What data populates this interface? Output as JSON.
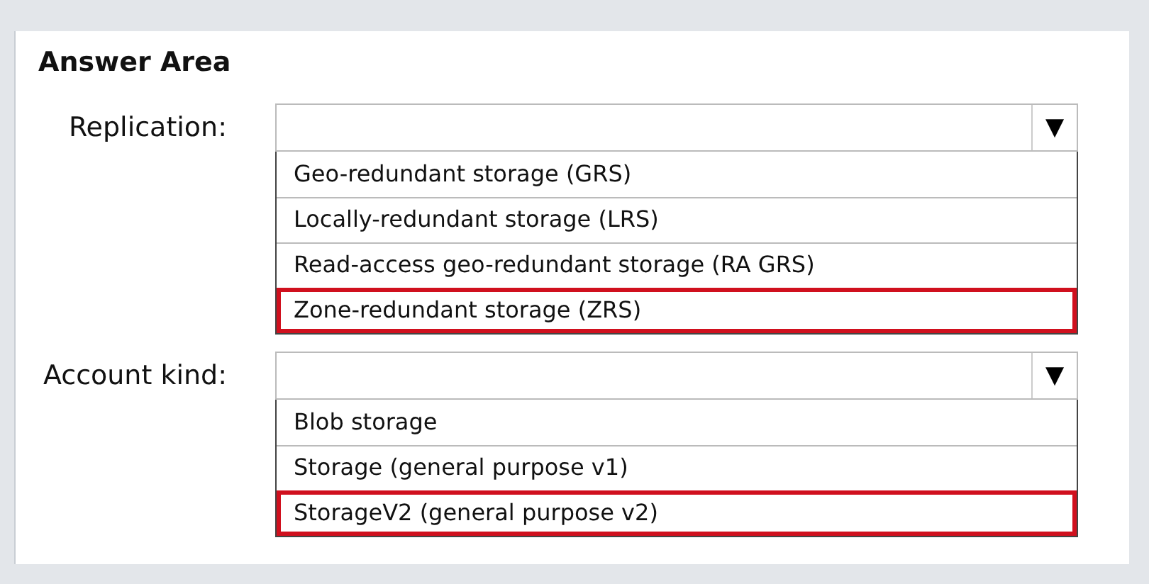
{
  "title": "Answer Area",
  "dropdowns": [
    {
      "label": "Replication:",
      "arrow": "▼",
      "options": [
        {
          "text": "Geo-redundant storage (GRS)",
          "selected": false
        },
        {
          "text": "Locally-redundant storage (LRS)",
          "selected": false
        },
        {
          "text": "Read-access geo-redundant storage (RA GRS)",
          "selected": false
        },
        {
          "text": "Zone-redundant storage (ZRS)",
          "selected": true
        }
      ]
    },
    {
      "label": "Account kind:",
      "arrow": "▼",
      "options": [
        {
          "text": "Blob storage",
          "selected": false
        },
        {
          "text": "Storage (general purpose v1)",
          "selected": false
        },
        {
          "text": "StorageV2 (general purpose v2)",
          "selected": true
        }
      ]
    }
  ]
}
